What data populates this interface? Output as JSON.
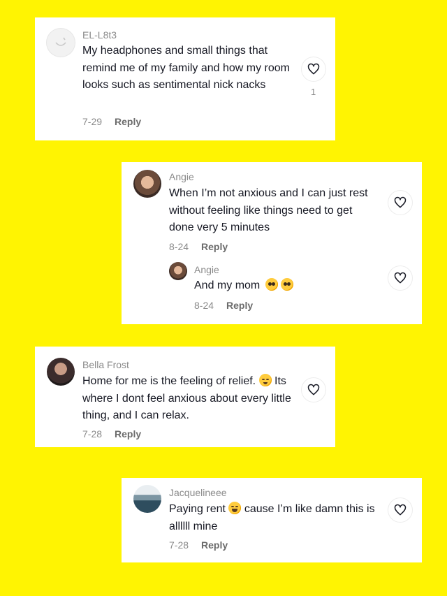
{
  "comments": [
    {
      "username": "EL-L8t3",
      "text": "My headphones and small things that remind me of my family and how my room looks such as sentimental nick nacks",
      "date": "7-29",
      "reply_label": "Reply",
      "likes": "1",
      "avatar": "default-avatar"
    },
    {
      "username": "Angie",
      "text": "When I’m not anxious and I can just rest without feeling like things need to get done very 5 minutes",
      "date": "8-24",
      "reply_label": "Reply",
      "avatar": "photo-avatar",
      "reply": {
        "username": "Angie",
        "text": "And my mom",
        "emojis": [
          "pleading-face-emoji",
          "pleading-face-emoji"
        ],
        "date": "8-24",
        "reply_label": "Reply"
      }
    },
    {
      "username": "Bella Frost",
      "text": "Home for me is the feeling of relief.",
      "text_emoji": "relieved-face-emoji",
      "text_cont": "Its where I dont feel anxious about every little thing, and I can relax.",
      "date": "7-28",
      "reply_label": "Reply",
      "avatar": "photo-avatar"
    },
    {
      "username": "Jacquelineee",
      "text": "Paying rent",
      "text_emoji": "laughing-face-emoji",
      "text_cont": "cause I’m like damn this is allllll mine",
      "date": "7-28",
      "reply_label": "Reply",
      "avatar": "ocean-photo-avatar"
    }
  ],
  "colors": {
    "background": "#fff402",
    "card": "#ffffff",
    "text": "#161823",
    "muted": "#8a8a8a"
  }
}
